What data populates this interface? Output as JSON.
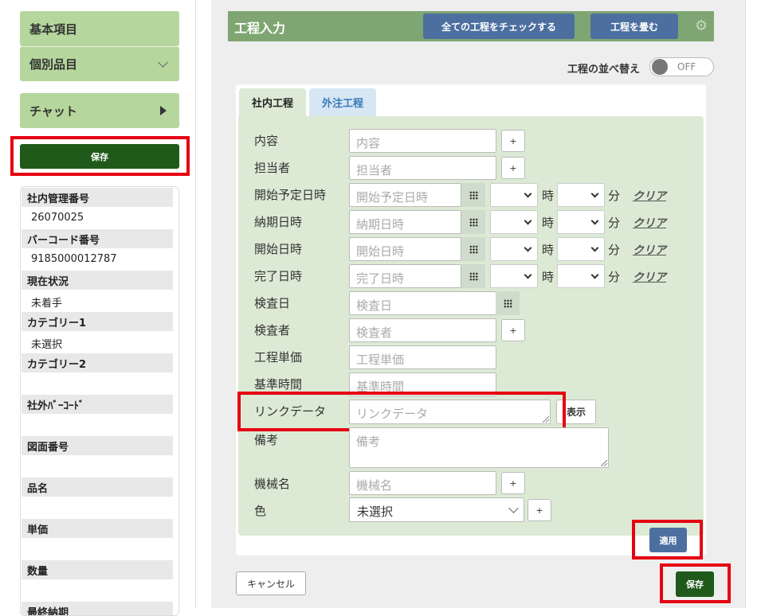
{
  "sidebar": {
    "accordion": [
      {
        "label": "基本項目"
      },
      {
        "label": "個別品目"
      },
      {
        "label": "チャット"
      }
    ],
    "save_label": "保存",
    "info": [
      {
        "label": "社内管理番号",
        "value": "26070025"
      },
      {
        "label": "バーコード番号",
        "value": "9185000012787"
      },
      {
        "label": "現在状況",
        "value": "未着手"
      },
      {
        "label": "カテゴリー1",
        "value": "未選択"
      },
      {
        "label": "カテゴリー2",
        "value": ""
      },
      {
        "label": "社外ﾊﾞｰｺｰﾄﾞ",
        "value": ""
      },
      {
        "label": "図面番号",
        "value": ""
      },
      {
        "label": "品名",
        "value": ""
      },
      {
        "label": "単価",
        "value": ""
      },
      {
        "label": "数量",
        "value": ""
      },
      {
        "label": "最終納期",
        "value": ""
      }
    ]
  },
  "process": {
    "title": "工程入力",
    "check_all_label": "全ての工程をチェックする",
    "collapse_label": "工程を畳む",
    "sort_label": "工程の並べ替え",
    "toggle_state": "OFF",
    "tabs": [
      {
        "label": "社内工程"
      },
      {
        "label": "外注工程"
      }
    ],
    "plus_label": "+",
    "hour_unit": "時",
    "minute_unit": "分",
    "clear_label": "クリア",
    "show_label": "表示",
    "fields": {
      "content": {
        "label": "内容",
        "placeholder": "内容"
      },
      "assignee": {
        "label": "担当者",
        "placeholder": "担当者"
      },
      "planned_start": {
        "label": "開始予定日時",
        "placeholder": "開始予定日時"
      },
      "due": {
        "label": "納期日時",
        "placeholder": "納期日時"
      },
      "start": {
        "label": "開始日時",
        "placeholder": "開始日時"
      },
      "end": {
        "label": "完了日時",
        "placeholder": "完了日時"
      },
      "inspection_date": {
        "label": "検査日",
        "placeholder": "検査日"
      },
      "inspector": {
        "label": "検査者",
        "placeholder": "検査者"
      },
      "unit_price": {
        "label": "工程単価",
        "placeholder": "工程単価"
      },
      "standard_time": {
        "label": "基準時間",
        "placeholder": "基準時間"
      },
      "link_data": {
        "label": "リンクデータ",
        "placeholder": "リンクデータ"
      },
      "remarks": {
        "label": "備考",
        "placeholder": "備考"
      },
      "machine": {
        "label": "機械名",
        "placeholder": "機械名"
      },
      "color": {
        "label": "色",
        "value": "未選択"
      }
    },
    "apply_label": "適用",
    "cancel_label": "キャンセル",
    "save_label": "保存"
  },
  "colors": {
    "highlight": "#e60012",
    "save_green": "#1f5a1a",
    "accent_blue": "#4c6fa0",
    "form_green": "#dcead5",
    "accordion_green": "#b5d69c"
  }
}
